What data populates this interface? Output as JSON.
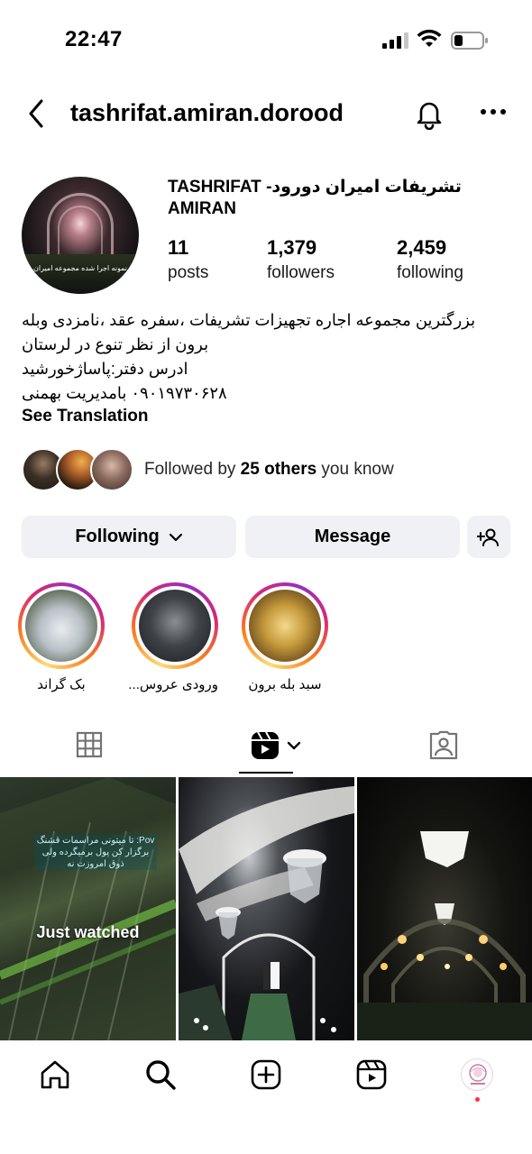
{
  "status_bar": {
    "time": "22:47"
  },
  "header": {
    "username": "tashrifat.amiran.dorood"
  },
  "profile": {
    "avatar_caption": "نمونه اجرا شده مجموعه امیران",
    "full_name": "تشریفات امیران دورود- TASHRIFAT AMIRAN",
    "stats": [
      {
        "value": "11",
        "label": "posts"
      },
      {
        "value": "1,379",
        "label": "followers"
      },
      {
        "value": "2,459",
        "label": "following"
      }
    ],
    "bio_lines": [
      "بزرگترین مجموعه اجاره تجهیزات تشریفات ،سفره عقد ،نامزدی وبله",
      "برون از نظر تنوع در لرستان",
      "ادرس دفتر:پاساژخورشید",
      "۰۹۰۱۹۷۳۰۶۲۸ بامدیریت بهمنی"
    ],
    "see_translation": "See Translation",
    "followed_by": {
      "prefix": "Followed by ",
      "count": "25 others",
      "suffix": " you know"
    }
  },
  "actions": {
    "following": "Following",
    "message": "Message"
  },
  "highlights": [
    {
      "label": "بک گراند"
    },
    {
      "label": "ورودی عروس..."
    },
    {
      "label": "سبد بله برون"
    }
  ],
  "grid": {
    "items": [
      {
        "overlay": "Just watched",
        "caption": "Pov: تا میتونی مراسمات قشنگ برگزار کن پول برمیگرده ولی ذوق امروزت نه"
      },
      {
        "overlay": ""
      },
      {
        "overlay": ""
      }
    ]
  },
  "colors": {
    "button_bg": "#eff1f5",
    "story_ring": [
      "#feda75",
      "#fa7e1e",
      "#d62976",
      "#962fbf"
    ],
    "notification_dot": "#ff3040"
  },
  "icons": [
    "signal-icon",
    "wifi-icon",
    "battery-icon",
    "back-icon",
    "bell-icon",
    "more-icon",
    "chevron-down-icon",
    "add-person-icon",
    "grid-icon",
    "reels-icon",
    "tagged-icon",
    "home-icon",
    "search-icon",
    "create-icon",
    "reels-nav-icon"
  ]
}
